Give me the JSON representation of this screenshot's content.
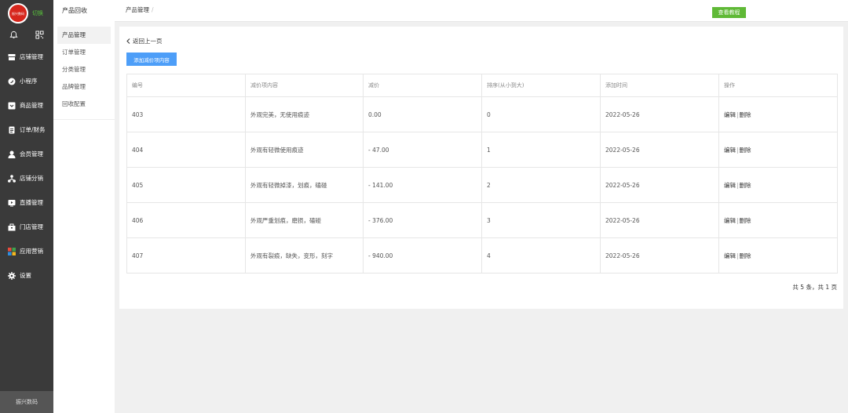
{
  "sidebar": {
    "logo_text": "振兴数码",
    "switch_label": "切换",
    "items": [
      {
        "label": "店铺管理",
        "icon": "store-icon"
      },
      {
        "label": "小程序",
        "icon": "miniprogram-icon"
      },
      {
        "label": "商品管理",
        "icon": "goods-icon"
      },
      {
        "label": "订单/财务",
        "icon": "order-icon"
      },
      {
        "label": "会员管理",
        "icon": "member-icon"
      },
      {
        "label": "店铺分销",
        "icon": "distribution-icon"
      },
      {
        "label": "直播管理",
        "icon": "live-icon"
      },
      {
        "label": "门店管理",
        "icon": "shop-icon"
      },
      {
        "label": "应用营销",
        "icon": "apps-icon"
      },
      {
        "label": "设置",
        "icon": "gear-icon"
      }
    ],
    "footer": "振兴数码"
  },
  "subnav": {
    "title": "产品回收",
    "items": [
      {
        "label": "产品管理",
        "active": true
      },
      {
        "label": "订单管理",
        "active": false
      },
      {
        "label": "分类管理",
        "active": false
      },
      {
        "label": "品牌管理",
        "active": false
      },
      {
        "label": "回收配置",
        "active": false
      }
    ]
  },
  "header": {
    "breadcrumb": "产品管理",
    "breadcrumb_sep": "/",
    "tutorial_button": "查看教程"
  },
  "main": {
    "back_link": "返回上一页",
    "add_button": "添加减价项内容",
    "table": {
      "headers": [
        "编号",
        "减价项内容",
        "减价",
        "排序(从小到大)",
        "添加时间",
        "操作"
      ],
      "rows": [
        {
          "id": "403",
          "content": "外观完美，无使用痕迹",
          "deduct": "0.00",
          "sort": "0",
          "time": "2022-05-26"
        },
        {
          "id": "404",
          "content": "外观有轻微使用痕迹",
          "deduct": "- 47.00",
          "sort": "1",
          "time": "2022-05-26"
        },
        {
          "id": "405",
          "content": "外观有轻微掉漆，划痕，磕碰",
          "deduct": "- 141.00",
          "sort": "2",
          "time": "2022-05-26"
        },
        {
          "id": "406",
          "content": "外观严重划痕，磨损，磕碰",
          "deduct": "- 376.00",
          "sort": "3",
          "time": "2022-05-26"
        },
        {
          "id": "407",
          "content": "外观有裂痕，缺失，变形，刻字",
          "deduct": "- 940.00",
          "sort": "4",
          "time": "2022-05-26"
        }
      ],
      "edit_label": "编辑",
      "op_sep": "|",
      "delete_label": "删除"
    },
    "pagination": "共 5 条，共 1 页"
  },
  "colors": {
    "sidebar_bg": "#3a3a3a",
    "accent_blue": "#4d9ef8",
    "accent_green": "#5fb936",
    "logo_red": "#d7261c"
  }
}
